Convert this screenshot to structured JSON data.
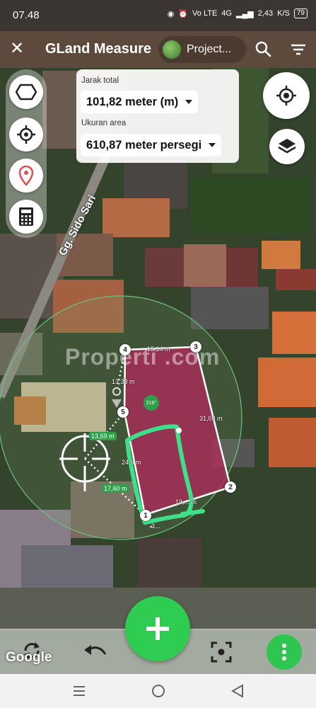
{
  "status_bar": {
    "time": "07.48",
    "network": "4G",
    "volte": "Vo LTE",
    "speed": "2,43",
    "speed_unit": "K/S",
    "battery": "79"
  },
  "app_bar": {
    "title": "GLand Measure",
    "project_label": "Project..."
  },
  "measure_panel": {
    "distance_label": "Jarak total",
    "distance_value": "101,82 meter (m)",
    "area_label": "Ukuran area",
    "area_value": "610,87 meter persegi"
  },
  "map": {
    "street_label": "Gg. Sido Sari",
    "watermark": "Properti .com",
    "attribution": "Google",
    "vertices": [
      "1",
      "2",
      "3",
      "4",
      "5"
    ],
    "edge_labels": {
      "e43": "15,14 m",
      "e32": "31,09 m",
      "e21": "19,... m",
      "e45": "13,33 m",
      "e5c": "13,59 m",
      "e51": "24,9 m",
      "ec1": "17,60 m",
      "e1b": "3..."
    },
    "angle_label": "216°"
  },
  "colors": {
    "status_bar": "#3b3631",
    "app_bar": "#5e4a3c",
    "fab": "#2ecc50",
    "polygon_fill": "#b02a5a",
    "highlight_stroke": "#3ee08a"
  }
}
